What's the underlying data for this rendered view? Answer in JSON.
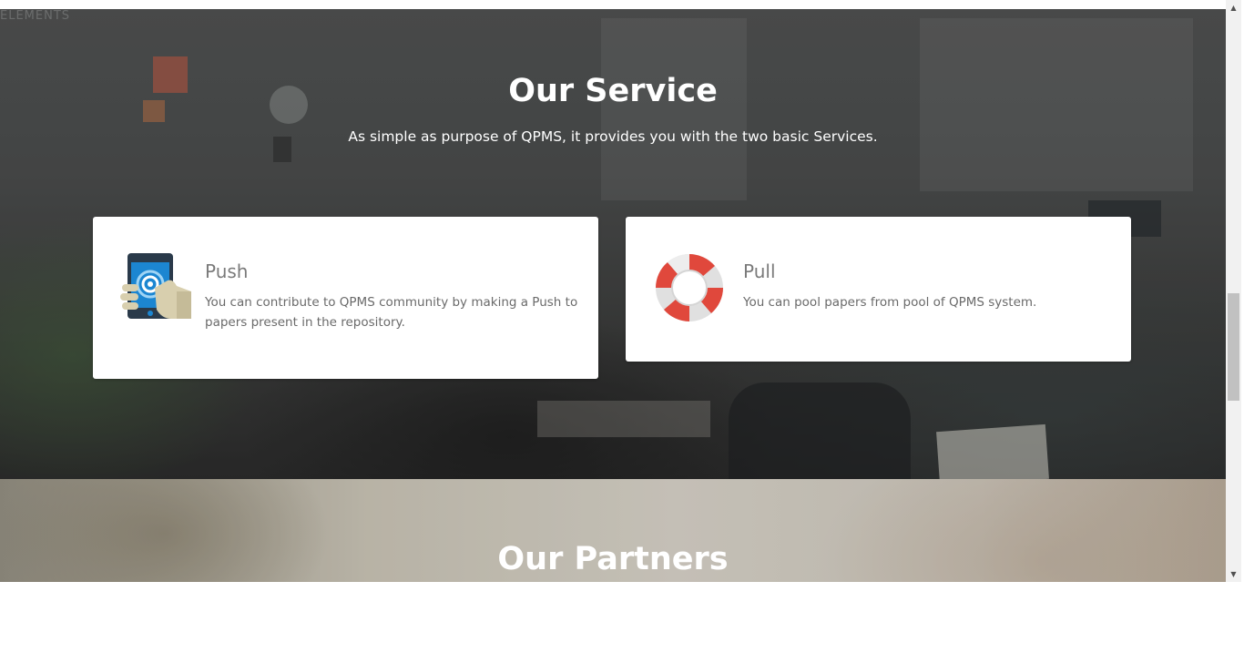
{
  "service": {
    "title": "Our Service",
    "subtitle": "As simple as purpose of QPMS, it provides you with the two basic Services.",
    "wall_text": "ELEMENTS",
    "cards": [
      {
        "icon": "hand-phone-touch-icon",
        "heading": "Push",
        "text": "You can contribute to QPMS community by making a Push to papers present in the repository."
      },
      {
        "icon": "lifebuoy-icon",
        "heading": "Pull",
        "text": "You can pool papers from pool of QPMS system."
      }
    ]
  },
  "partners": {
    "title": "Our Partners"
  },
  "scrollbar": {
    "up_glyph": "▲",
    "down_glyph": "▼"
  },
  "colors": {
    "card_background": "#ffffff",
    "heading_gray": "#7a7a7a",
    "lifebuoy_red": "#e0483c",
    "phone_blue": "#1c86d1"
  }
}
